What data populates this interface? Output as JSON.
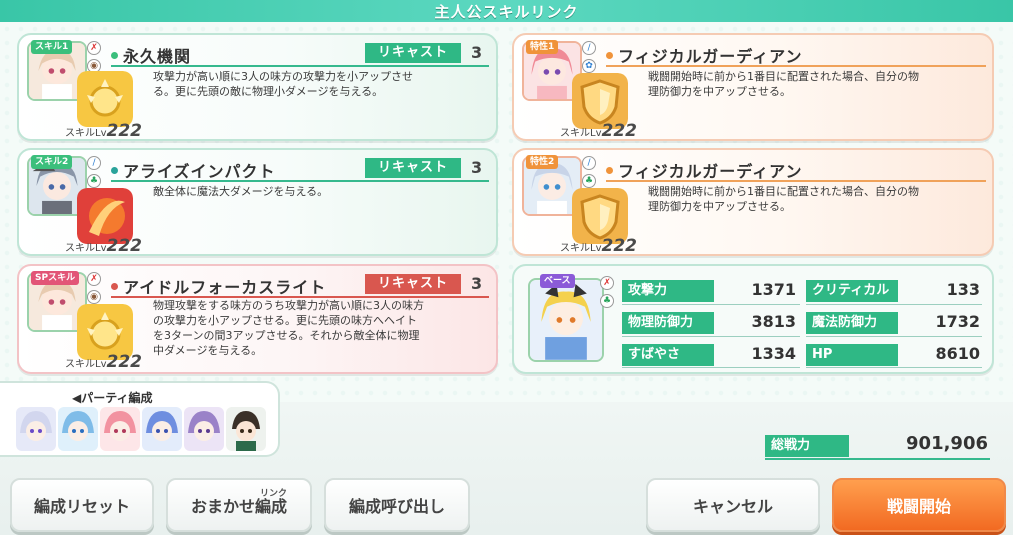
{
  "header": {
    "title": "主人公スキルリンク"
  },
  "skills": [
    {
      "tag": "スキル1",
      "name": "永久機関",
      "recast_label": "リキャスト",
      "recast": "3",
      "desc": [
        "攻撃力が高い順に3人の味方の攻撃力を小アップさせ",
        "る。更に先頭の敵に物理小ダメージを与える。"
      ],
      "lv_label": "スキルLv",
      "lv": "222"
    },
    {
      "tag": "スキル2",
      "name": "アライズインパクト",
      "recast_label": "リキャスト",
      "recast": "3",
      "desc": [
        "敵全体に魔法大ダメージを与える。"
      ],
      "lv_label": "スキルLv",
      "lv": "222"
    },
    {
      "tag": "SPスキル",
      "name": "アイドルフォーカスライト",
      "recast_label": "リキャスト",
      "recast": "3",
      "desc": [
        "物理攻撃をする味方のうち攻撃力が高い順に3人の味方",
        "の攻撃力を小アップさせる。更に先頭の味方へヘイト",
        "を3ターンの間3アップさせる。それから敵全体に物理",
        "中ダメージを与える。"
      ],
      "lv_label": "スキルLv",
      "lv": "222"
    }
  ],
  "traits": [
    {
      "tag": "特性1",
      "name": "フィジカルガーディアン",
      "desc": [
        "戦闘開始時に前から1番目に配置された場合、自分の物",
        "理防御力を中アップさせる。"
      ],
      "lv_label": "スキルLv",
      "lv": "222"
    },
    {
      "tag": "特性2",
      "name": "フィジカルガーディアン",
      "desc": [
        "戦闘開始時に前から1番目に配置された場合、自分の物",
        "理防御力を中アップさせる。"
      ],
      "lv_label": "スキルLv",
      "lv": "222"
    }
  ],
  "base": {
    "tag": "ベース",
    "stats": [
      {
        "label": "攻撃力",
        "value": "1371"
      },
      {
        "label": "クリティカル",
        "value": "133"
      },
      {
        "label": "物理防御力",
        "value": "3813"
      },
      {
        "label": "魔法防御力",
        "value": "1732"
      },
      {
        "label": "すばやさ",
        "value": "1334"
      },
      {
        "label": "HP",
        "value": "8610"
      }
    ]
  },
  "party": {
    "label": "◀パーティ編成"
  },
  "power": {
    "label": "総戦力",
    "value": "901,906"
  },
  "buttons": {
    "reset": "編成リセット",
    "auto": "おまかせ編成",
    "auto_ruby": "リンク",
    "recall": "編成呼び出し",
    "cancel": "キャンセル",
    "start": "戦闘開始"
  },
  "colors": {
    "accent": "#2fb885",
    "recast_sp": "#d9574f",
    "start_button": "#f26a22"
  }
}
